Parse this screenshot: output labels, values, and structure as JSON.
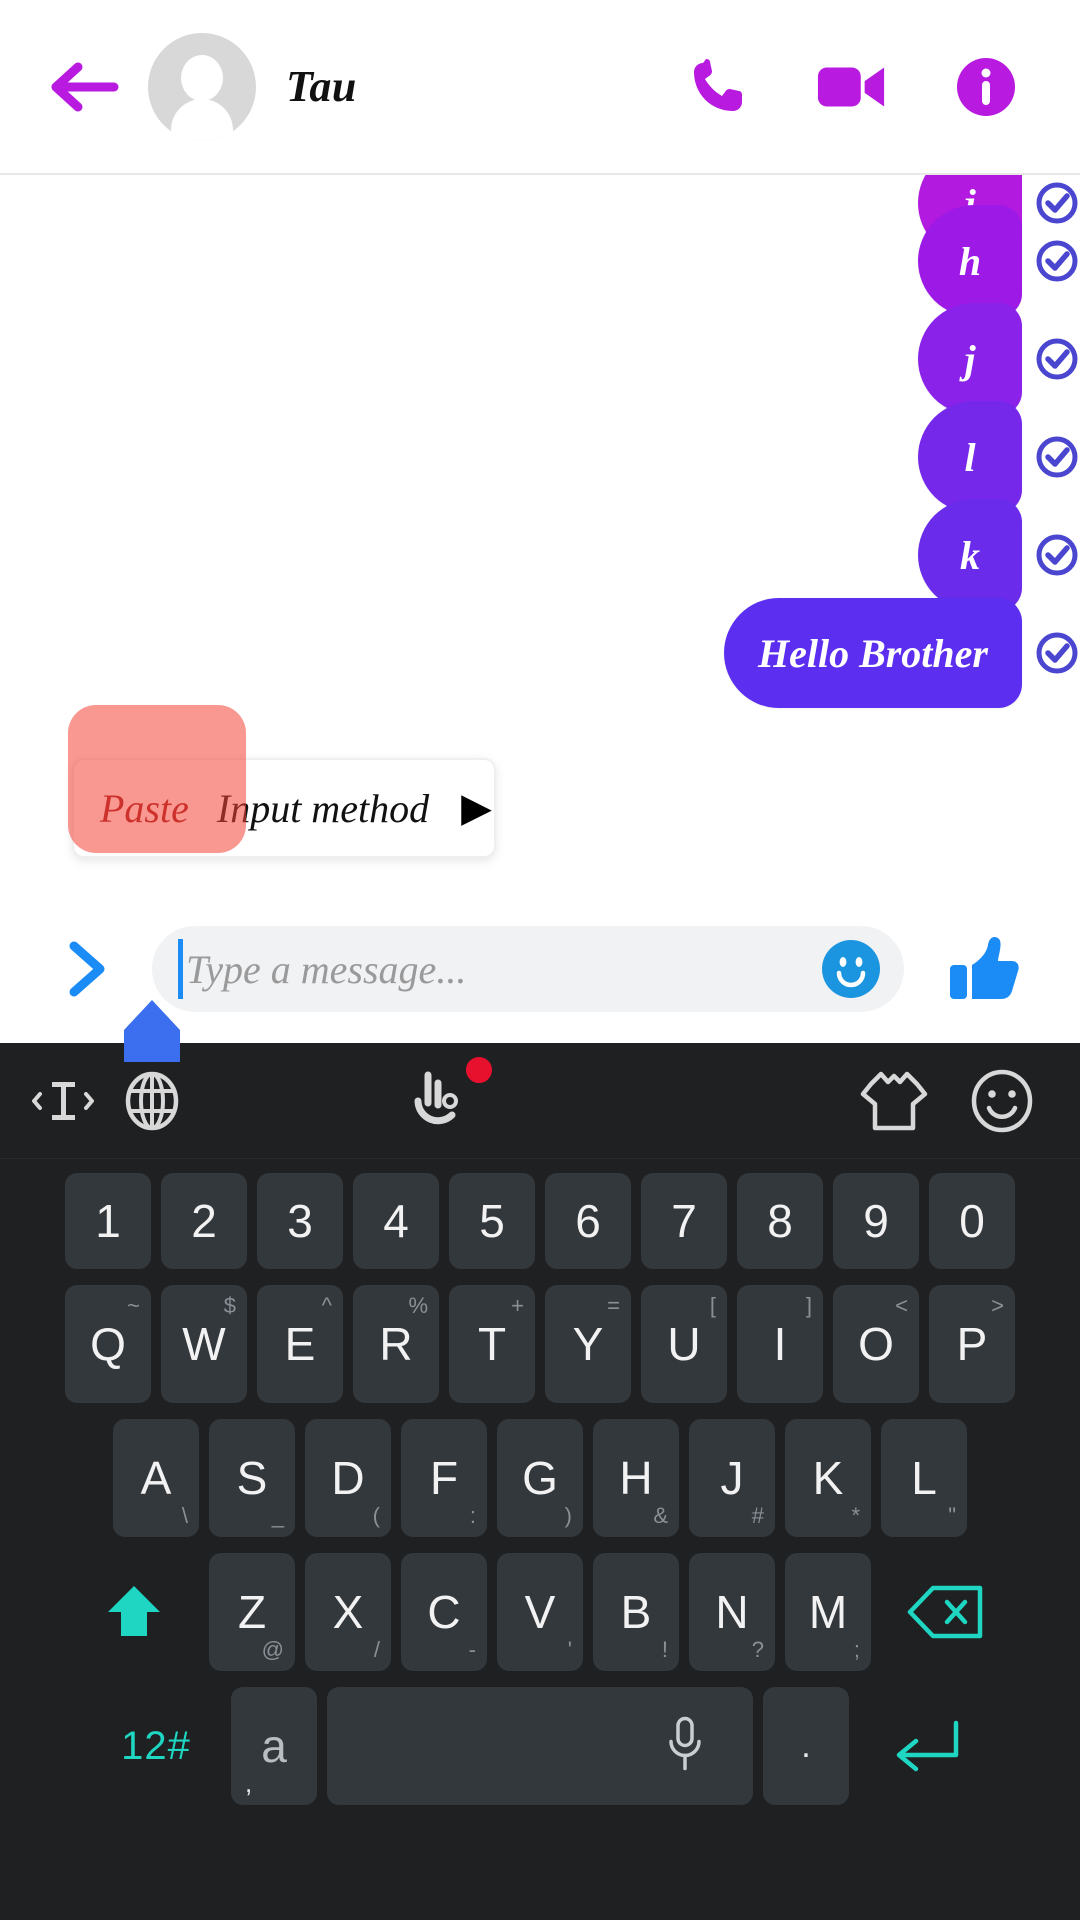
{
  "header": {
    "back_icon": "back-arrow-icon",
    "avatar_icon": "default-avatar-icon",
    "title": "Tau",
    "actions": [
      {
        "name": "voice-call-button",
        "icon": "phone-icon"
      },
      {
        "name": "video-call-button",
        "icon": "video-camera-icon"
      },
      {
        "name": "conversation-info-button",
        "icon": "info-icon"
      }
    ],
    "accent_color": "#b81ae0"
  },
  "chat": {
    "messages": [
      {
        "text": "j",
        "status": "sent",
        "bubble_color": "#b31ae0",
        "clipped": true
      },
      {
        "text": "h",
        "status": "sent",
        "bubble_color": "#9d1ae6"
      },
      {
        "text": "j",
        "status": "sent",
        "bubble_color": "#8a22ea"
      },
      {
        "text": "l",
        "status": "sent",
        "bubble_color": "#7528ea"
      },
      {
        "text": "k",
        "status": "sent",
        "bubble_color": "#6a2bea"
      },
      {
        "text": "Hello Brother",
        "status": "sent",
        "bubble_color": "#5c2ff0"
      }
    ],
    "status_icon": "check-circle-icon",
    "status_color": "#4a46cf"
  },
  "context_menu": {
    "items": [
      {
        "label": "Paste",
        "highlighted": true
      },
      {
        "label": "Input method",
        "highlighted": false
      }
    ],
    "submenu_arrow": "▶",
    "highlight_color": "#f44336"
  },
  "input_bar": {
    "expand_icon": "chevron-right-icon",
    "placeholder": "Type a message...",
    "value": "",
    "emoji_icon": "smiley-face-icon",
    "like_icon": "thumbs-up-icon",
    "cursor_handle_icon": "text-cursor-handle-icon",
    "accent_color": "#1b8cf5"
  },
  "keyboard": {
    "toolbar": [
      {
        "name": "cursor-control-icon",
        "label": "cursor-control"
      },
      {
        "name": "globe-icon",
        "label": "language"
      },
      {
        "name": "hand-gesture-icon",
        "label": "gesture",
        "badge": true
      },
      {
        "name": "tshirt-icon",
        "label": "theme"
      },
      {
        "name": "emoji-face-icon",
        "label": "emoji"
      }
    ],
    "rows": {
      "numbers": [
        "1",
        "2",
        "3",
        "4",
        "5",
        "6",
        "7",
        "8",
        "9",
        "0"
      ],
      "q_row": [
        {
          "main": "Q",
          "sub": "~"
        },
        {
          "main": "W",
          "sub": "$"
        },
        {
          "main": "E",
          "sub": "^"
        },
        {
          "main": "R",
          "sub": "%"
        },
        {
          "main": "T",
          "sub": "+"
        },
        {
          "main": "Y",
          "sub": "="
        },
        {
          "main": "U",
          "sub": "["
        },
        {
          "main": "I",
          "sub": "]"
        },
        {
          "main": "O",
          "sub": "<"
        },
        {
          "main": "P",
          "sub": ">"
        }
      ],
      "a_row": [
        {
          "main": "A",
          "sub": "\\"
        },
        {
          "main": "S",
          "sub": "_"
        },
        {
          "main": "D",
          "sub": "("
        },
        {
          "main": "F",
          "sub": ":"
        },
        {
          "main": "G",
          "sub": ")"
        },
        {
          "main": "H",
          "sub": "&"
        },
        {
          "main": "J",
          "sub": "#"
        },
        {
          "main": "K",
          "sub": "*"
        },
        {
          "main": "L",
          "sub": "\""
        }
      ],
      "z_row": [
        {
          "main": "Z",
          "sub": "@"
        },
        {
          "main": "X",
          "sub": "/"
        },
        {
          "main": "C",
          "sub": "-"
        },
        {
          "main": "V",
          "sub": "'"
        },
        {
          "main": "B",
          "sub": "!"
        },
        {
          "main": "N",
          "sub": "?"
        },
        {
          "main": "M",
          "sub": ";"
        }
      ],
      "bottom": {
        "symbols_label": "12#",
        "alt_main": "a",
        "alt_sub": ",",
        "space_label": "",
        "mic_icon": "microphone-icon",
        "period_label": ".",
        "enter_icon": "enter-arrow-icon"
      }
    },
    "shift_icon": "shift-arrow-icon",
    "backspace_icon": "backspace-icon",
    "accent_color": "#1fd6c2",
    "key_color": "#33383d",
    "background_color": "#1e2022"
  }
}
